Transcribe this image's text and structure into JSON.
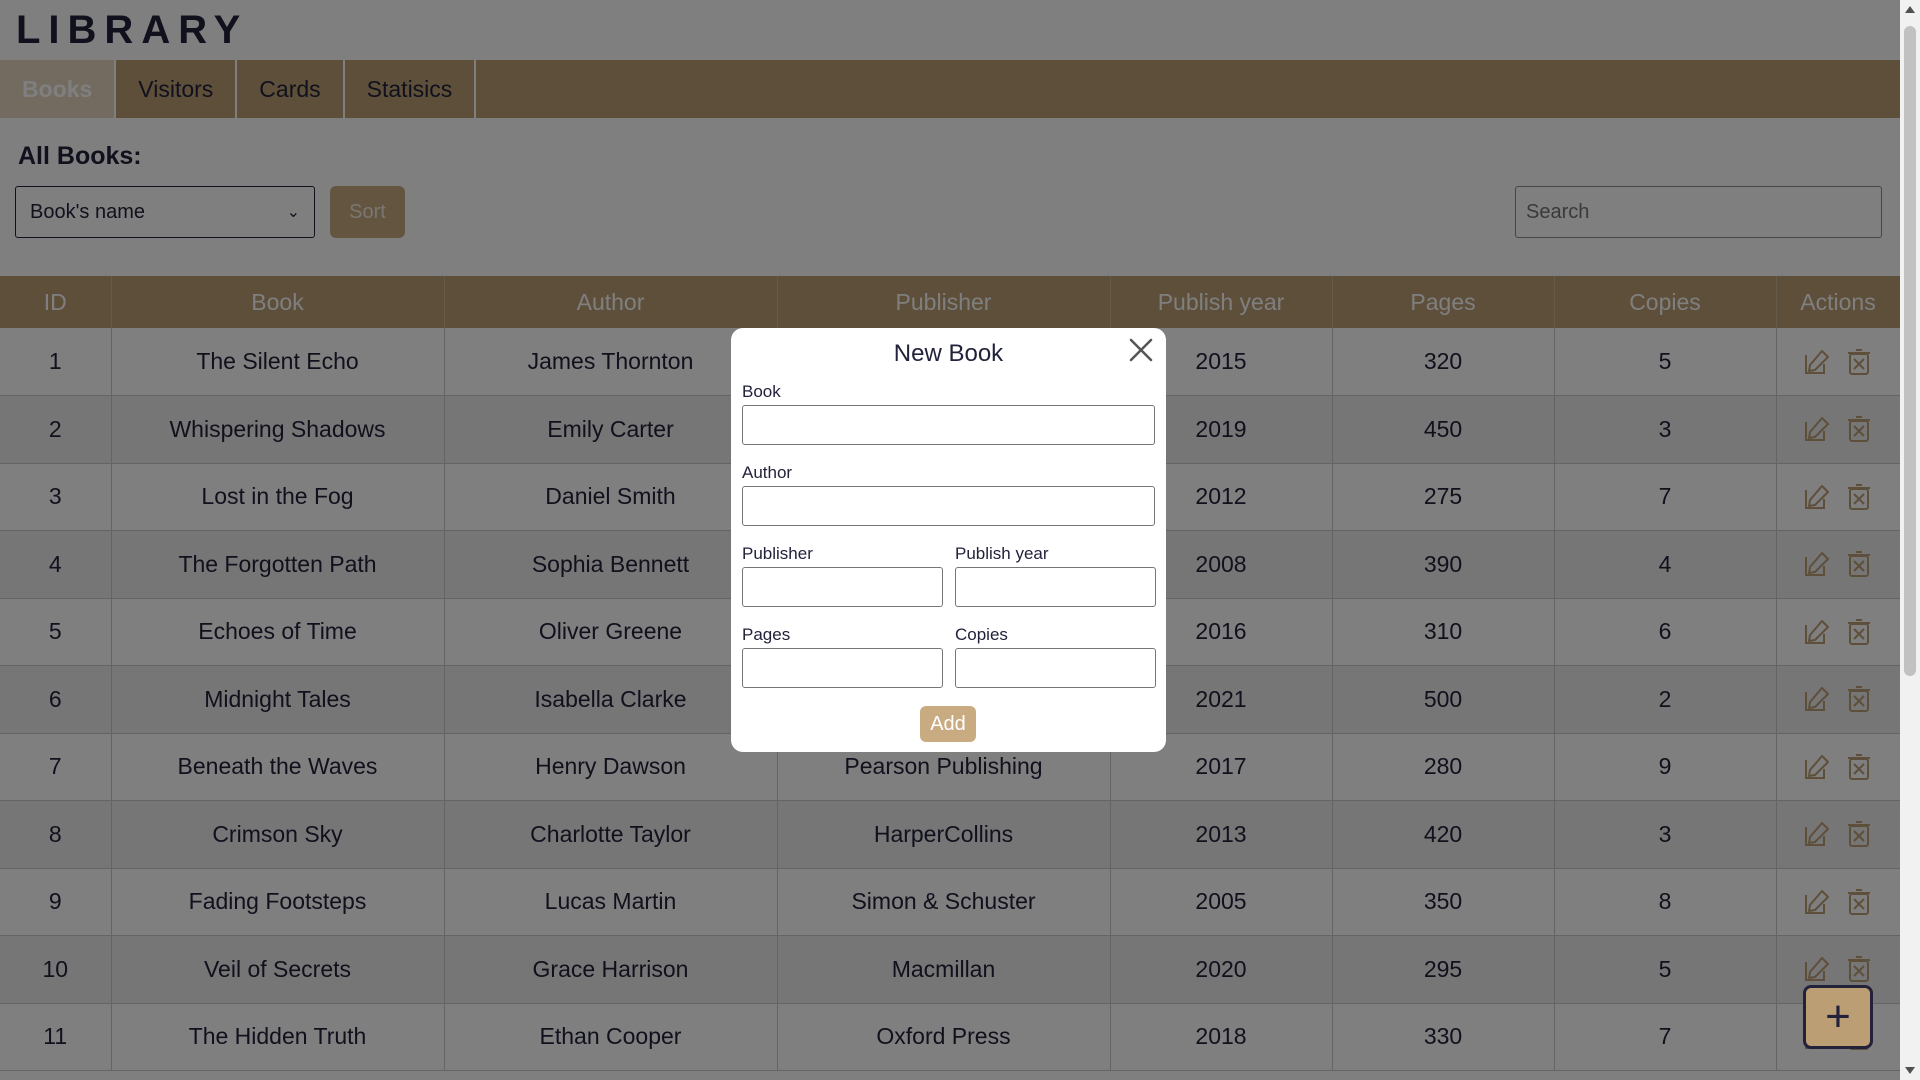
{
  "app": {
    "logo": "LIBRARY"
  },
  "nav": {
    "tabs": [
      {
        "label": "Books"
      },
      {
        "label": "Visitors"
      },
      {
        "label": "Cards"
      },
      {
        "label": "Statisics"
      }
    ]
  },
  "page": {
    "title": "All Books:"
  },
  "toolbar": {
    "sort_selected": "Book's name",
    "sort_button": "Sort",
    "search_placeholder": "Search"
  },
  "table": {
    "columns": [
      "ID",
      "Book",
      "Author",
      "Publisher",
      "Publish year",
      "Pages",
      "Copies",
      "Actions"
    ],
    "rows": [
      [
        "1",
        "The Silent Echo",
        "James Thornton",
        "",
        "2015",
        "320",
        "5"
      ],
      [
        "2",
        "Whispering Shadows",
        "Emily Carter",
        "",
        "2019",
        "450",
        "3"
      ],
      [
        "3",
        "Lost in the Fog",
        "Daniel Smith",
        "",
        "2012",
        "275",
        "7"
      ],
      [
        "4",
        "The Forgotten Path",
        "Sophia Bennett",
        "",
        "2008",
        "390",
        "4"
      ],
      [
        "5",
        "Echoes of Time",
        "Oliver Greene",
        "",
        "2016",
        "310",
        "6"
      ],
      [
        "6",
        "Midnight Tales",
        "Isabella Clarke",
        "",
        "2021",
        "500",
        "2"
      ],
      [
        "7",
        "Beneath the Waves",
        "Henry Dawson",
        "Pearson Publishing",
        "2017",
        "280",
        "9"
      ],
      [
        "8",
        "Crimson Sky",
        "Charlotte Taylor",
        "HarperCollins",
        "2013",
        "420",
        "3"
      ],
      [
        "9",
        "Fading Footsteps",
        "Lucas Martin",
        "Simon & Schuster",
        "2005",
        "350",
        "8"
      ],
      [
        "10",
        "Veil of Secrets",
        "Grace Harrison",
        "Macmillan",
        "2020",
        "295",
        "5"
      ],
      [
        "11",
        "The Hidden Truth",
        "Ethan Cooper",
        "Oxford Press",
        "2018",
        "330",
        "7"
      ]
    ]
  },
  "modal": {
    "title": "New Book",
    "book_label": "Book",
    "author_label": "Author",
    "publisher_label": "Publisher",
    "year_label": "Publish year",
    "pages_label": "Pages",
    "copies_label": "Copies",
    "add_button": "Add"
  },
  "fab": {
    "label": "+"
  },
  "icons": {
    "edit": "edit-icon",
    "delete": "delete-icon",
    "close": "close-icon",
    "add": "plus-icon"
  },
  "colors": {
    "primary": "#bc9e74",
    "accent": "#c9ab82",
    "text": "#22223b",
    "row_alt": "#ececec"
  }
}
